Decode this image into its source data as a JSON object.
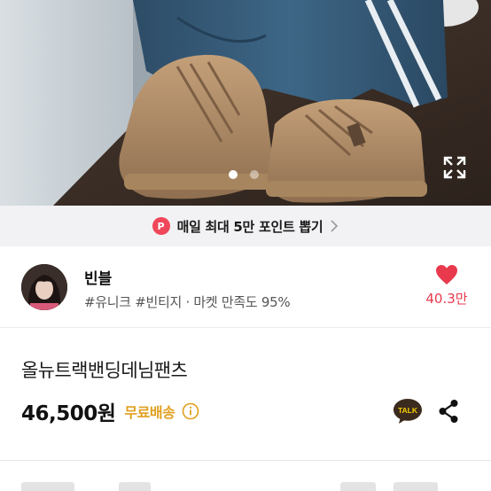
{
  "photo": {
    "slide_count": 2,
    "active_slide": 1,
    "expand_icon": "expand-icon"
  },
  "banner": {
    "badge": "P",
    "text": "매일 최대 5만 포인트 뽑기",
    "chevron_icon": "chevron-right-icon"
  },
  "seller": {
    "name": "빈블",
    "tags": "#유니크 #빈티지 · 마켓 만족도 95%",
    "like_count": "40.3만",
    "heart_icon": "heart-icon"
  },
  "product": {
    "title": "올뉴트랙밴딩데님팬츠",
    "price": "46,500원",
    "shipping": "무료배송",
    "talk_label": "TALK",
    "share_icon": "share-icon"
  },
  "colors": {
    "accent_red": "#e8394d",
    "badge_red": "#f0475a",
    "shipping_gold": "#e0a020",
    "banner_bg": "#f2f2f4"
  }
}
